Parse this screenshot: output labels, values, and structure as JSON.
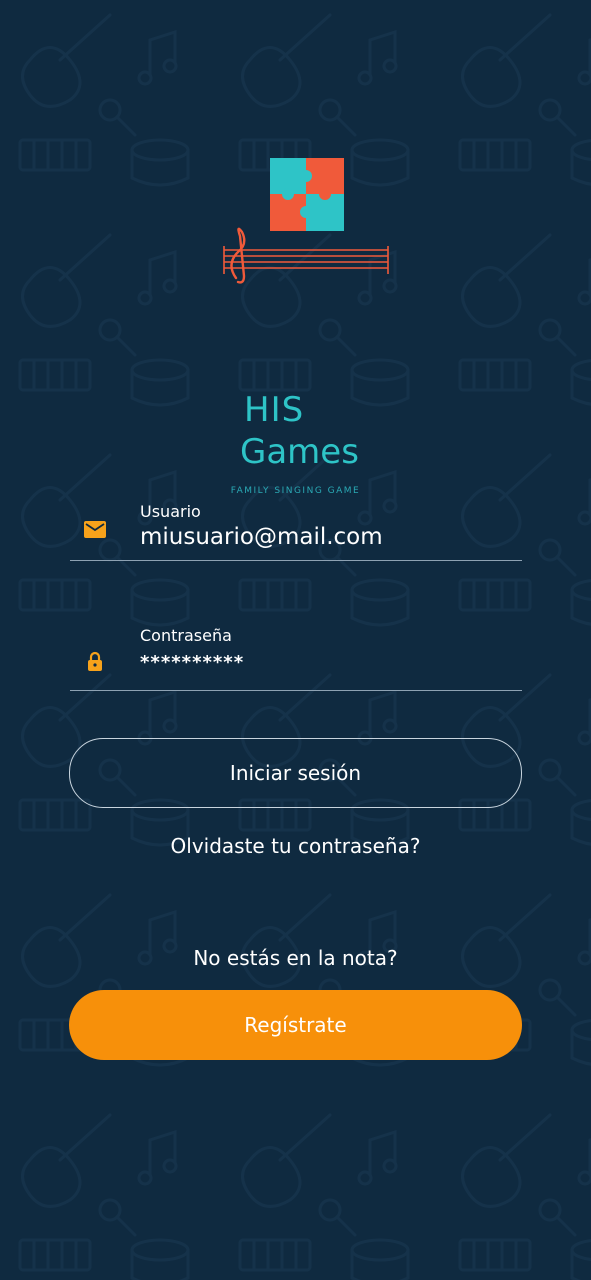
{
  "brand": {
    "line1": "HIS",
    "line2": "Games",
    "tagline": "FAMILY SINGING GAME",
    "colors": {
      "teal": "#2ec4c7",
      "coral": "#f05a3a",
      "background": "#0f2a40"
    }
  },
  "form": {
    "username": {
      "label": "Usuario",
      "value": "miusuario@mail.com",
      "icon": "mail-icon"
    },
    "password": {
      "label": "Contraseña",
      "value": "**********",
      "icon": "lock-icon"
    }
  },
  "actions": {
    "login_label": "Iniciar sesión",
    "forgot_label": "Olvidaste tu contraseña?",
    "not_in_note_label": "No estás en la nota?",
    "register_label": "Regístrate"
  },
  "colors": {
    "accent": "#f7900a",
    "icon": "#f7a21b"
  }
}
